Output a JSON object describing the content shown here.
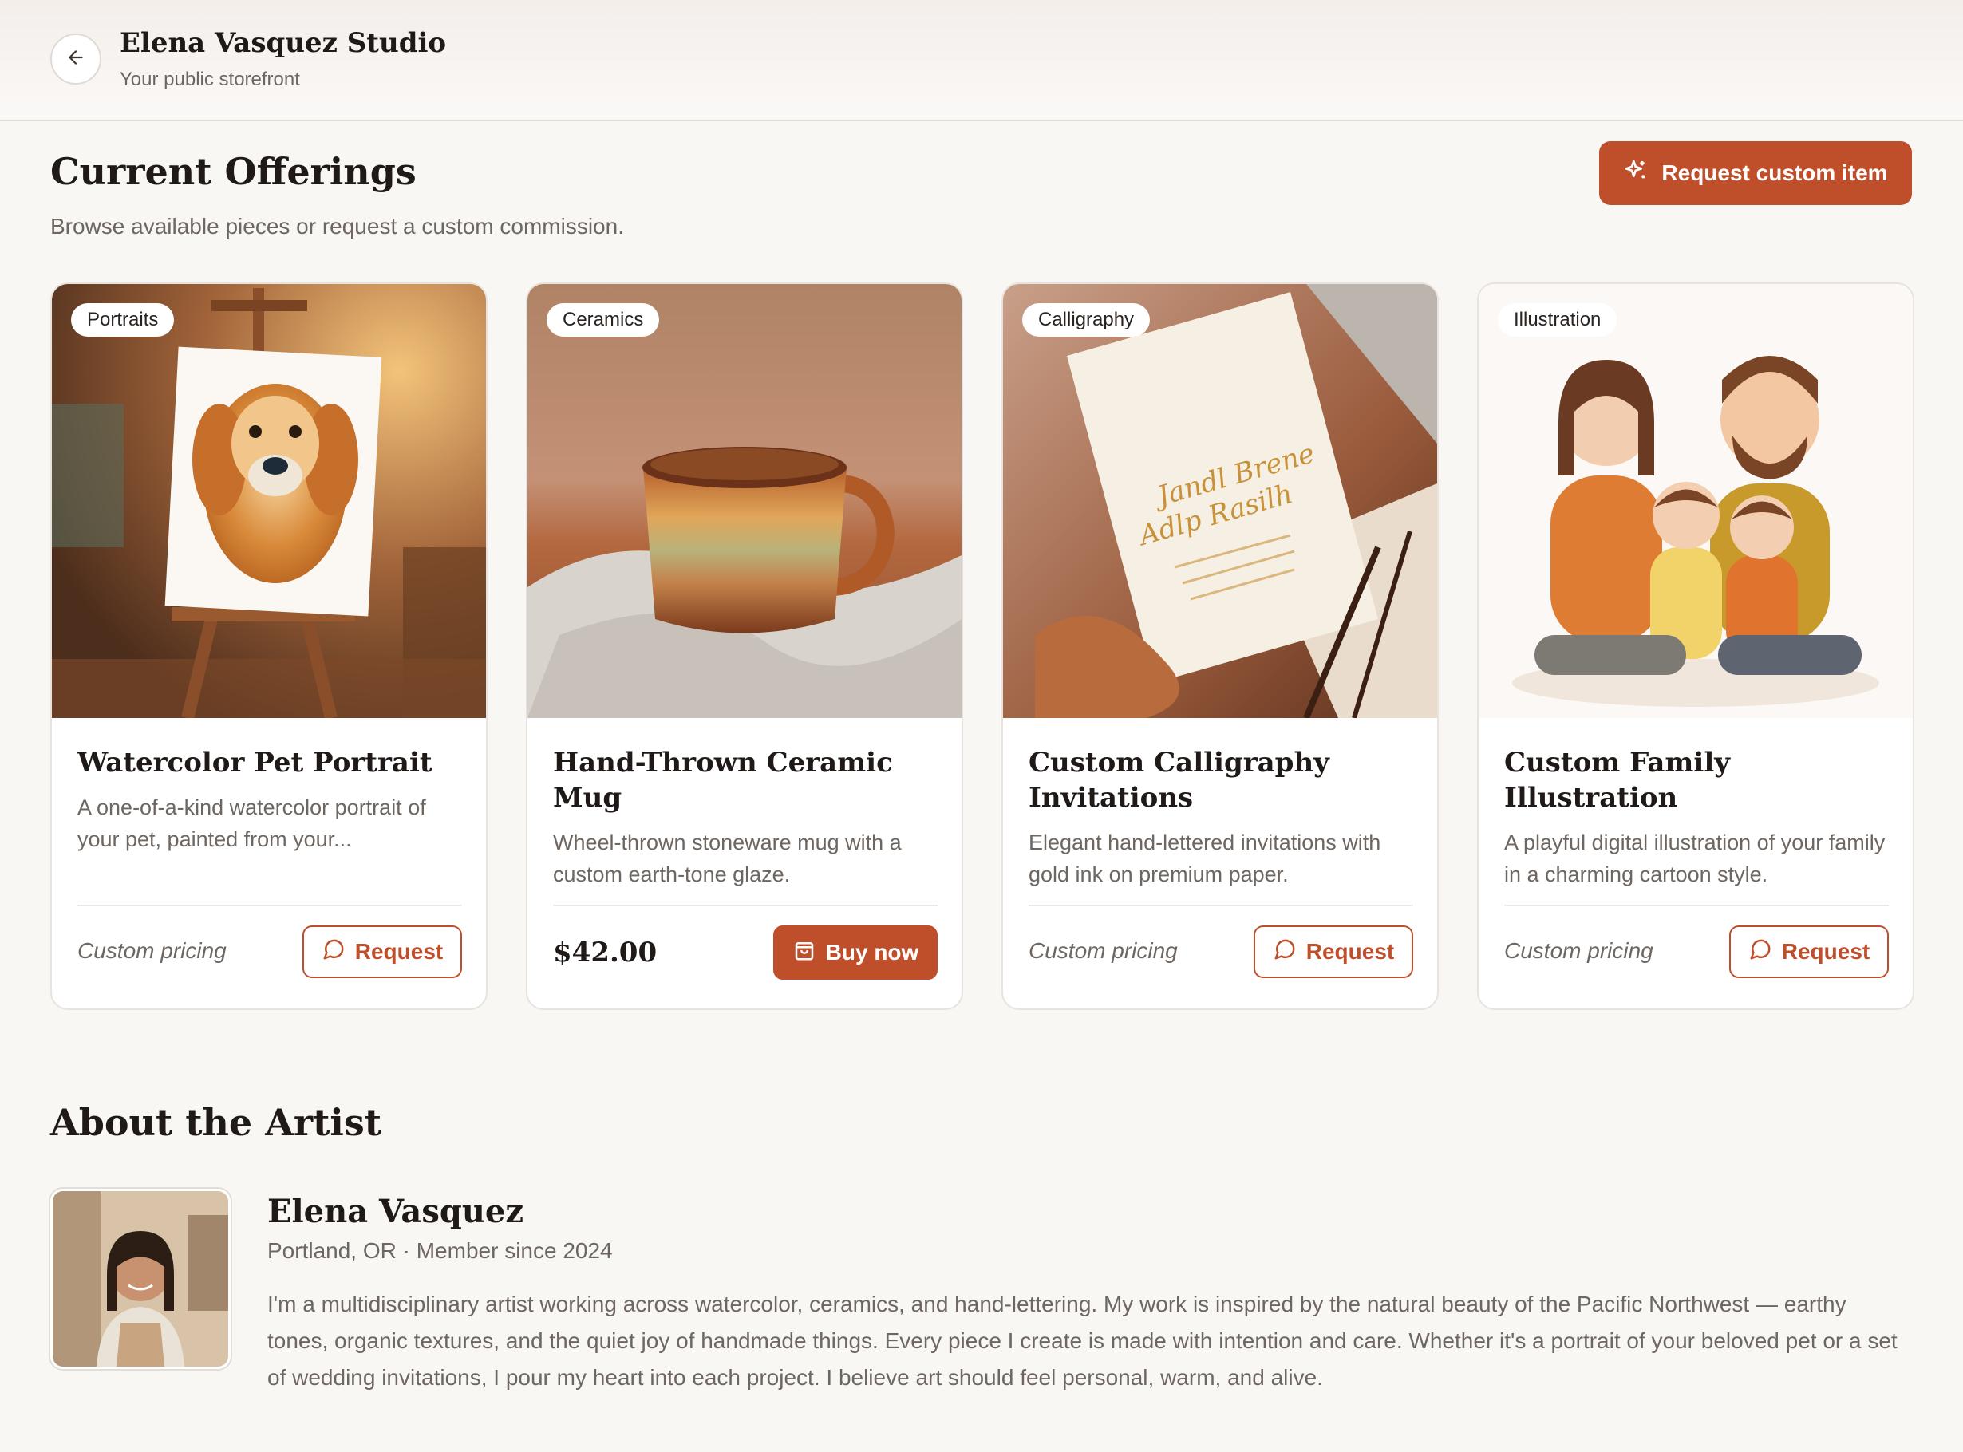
{
  "header": {
    "studio_name": "Elena Vasquez Studio",
    "subtitle": "Your public storefront"
  },
  "offerings": {
    "title": "Current Offerings",
    "subtitle": "Browse available pieces or request a custom commission.",
    "cta_label": "Request custom item",
    "cards": [
      {
        "tag": "Portraits",
        "title": "Watercolor Pet Portrait",
        "description": "A one-of-a-kind watercolor portrait of your pet, painted from your...",
        "price": "Custom pricing",
        "button": "Request"
      },
      {
        "tag": "Ceramics",
        "title": "Hand-Thrown Ceramic Mug",
        "description": "Wheel-thrown stoneware mug with a custom earth-tone glaze.",
        "price": "$42.00",
        "button": "Buy now"
      },
      {
        "tag": "Calligraphy",
        "title": "Custom Calligraphy Invitations",
        "description": "Elegant hand-lettered invitations with gold ink on premium paper.",
        "price": "Custom pricing",
        "button": "Request"
      },
      {
        "tag": "Illustration",
        "title": "Custom Family Illustration",
        "description": "A playful digital illustration of your family in a charming cartoon style.",
        "price": "Custom pricing",
        "button": "Request"
      }
    ]
  },
  "about": {
    "title": "About the Artist",
    "name": "Elena Vasquez",
    "meta": "Portland, OR · Member since 2024",
    "bio": "I'm a multidisciplinary artist working across watercolor, ceramics, and hand-lettering. My work is inspired by the natural beauty of the Pacific Northwest — earthy tones, organic textures, and the quiet joy of handmade things. Every piece I create is made with intention and care. Whether it's a portrait of your beloved pet or a set of wedding invitations, I pour my heart into each project. I believe art should feel personal, warm, and alive."
  },
  "colors": {
    "accent": "#bf4e2b",
    "background": "#f9f7f4",
    "muted_text": "#6e6660"
  },
  "icons": {
    "back": "arrow-left-icon",
    "cta": "sparkles-icon",
    "request": "message-circle-icon",
    "buy": "shopping-bag-icon"
  }
}
